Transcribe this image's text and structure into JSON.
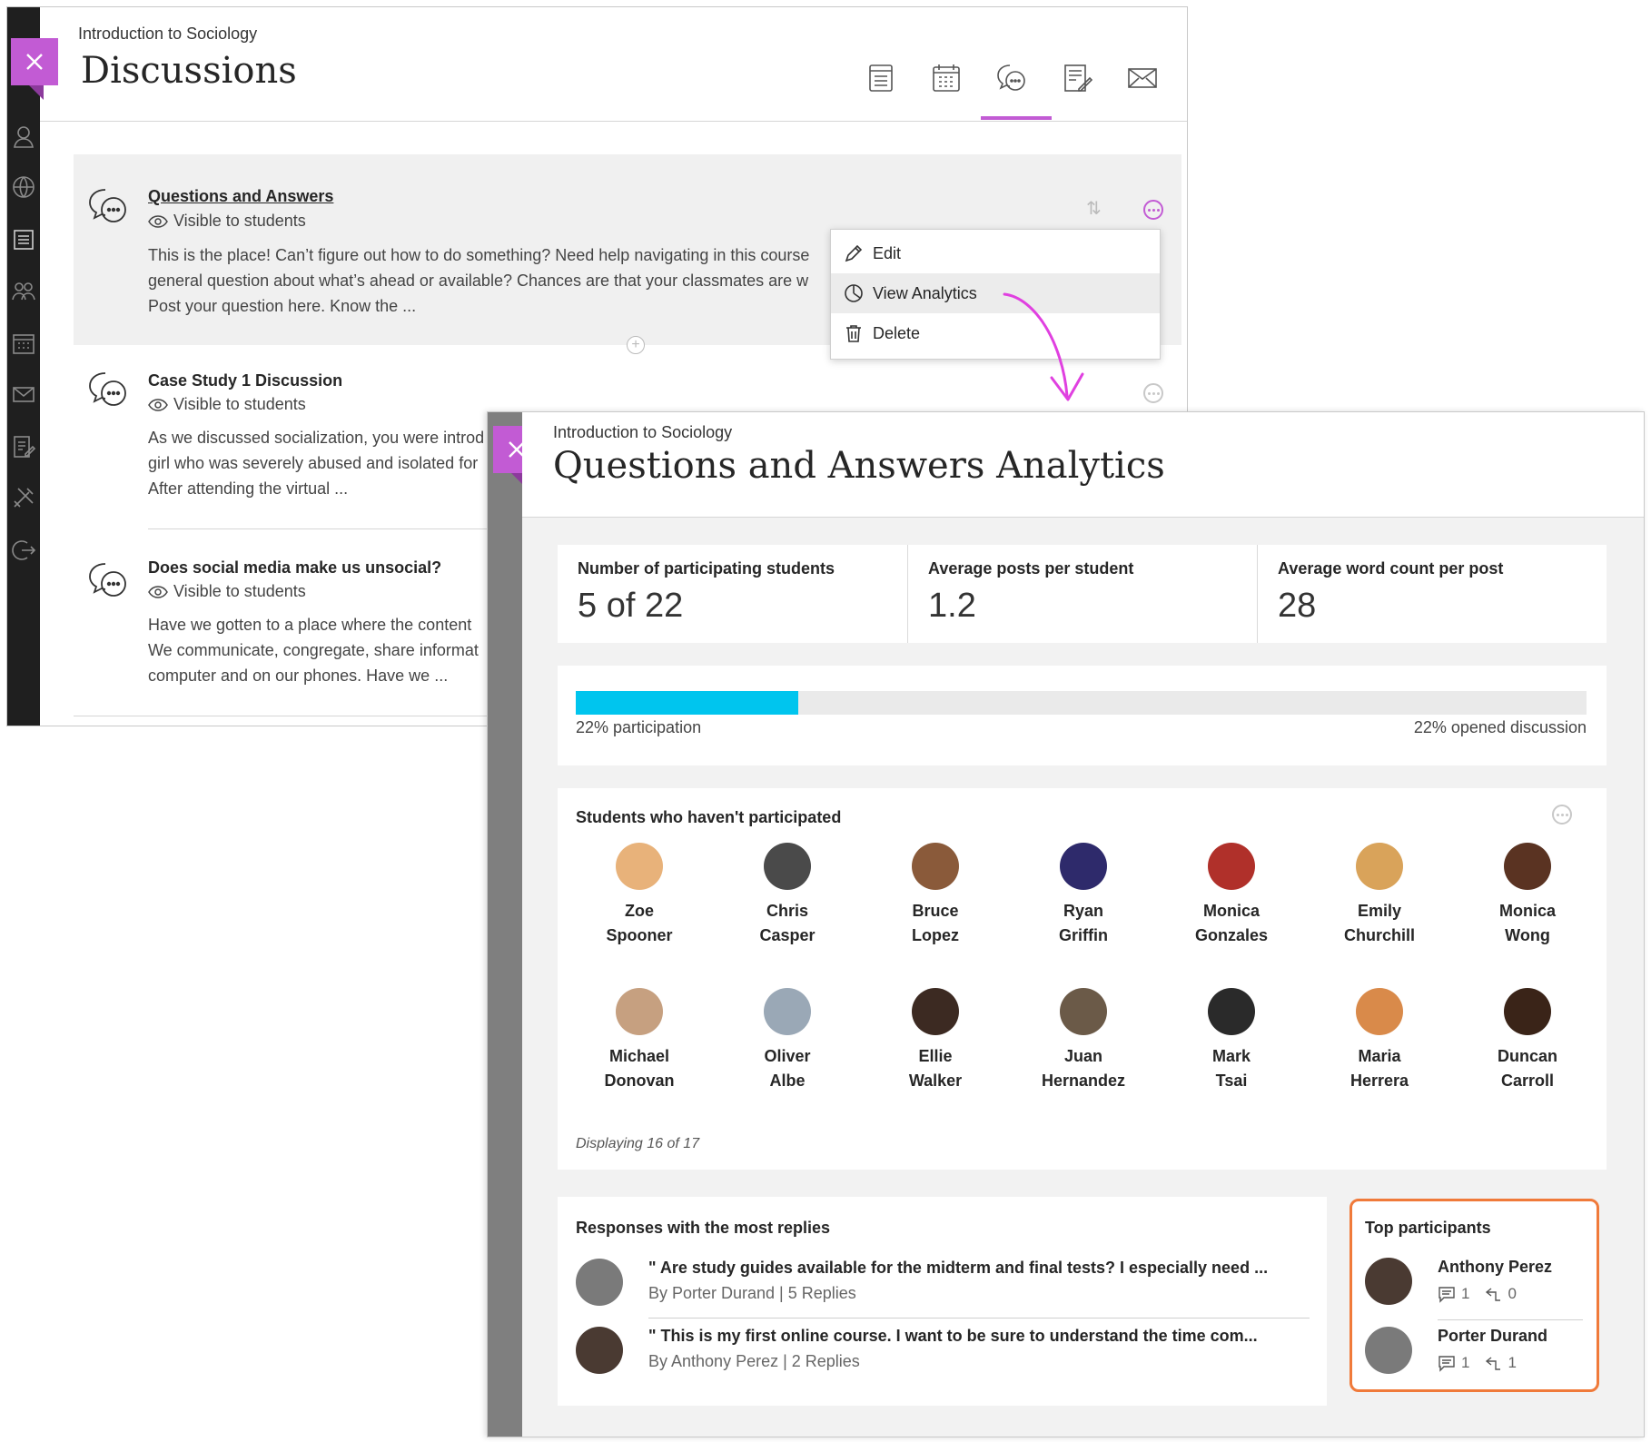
{
  "discussions_window": {
    "course": "Introduction to Sociology",
    "title": "Discussions",
    "toolbar_icons": [
      "content-icon",
      "calendar-icon",
      "discussions-icon",
      "gradebook-icon",
      "messages-icon"
    ],
    "items": [
      {
        "title": "Questions and Answers",
        "visibility": "Visible to students",
        "body": "This is the place! Can’t figure out how to do something? Need help navigating in this course\ngeneral question about what’s ahead or available? Chances are that your classmates are w\nPost your question here. Know the ..."
      },
      {
        "title": "Case Study 1 Discussion",
        "visibility": "Visible to students",
        "body": "As we discussed socialization, you were introd\ngirl who was severely abused and isolated for\nAfter attending the virtual ..."
      },
      {
        "title": "Does social media make us unsocial?",
        "visibility": "Visible to students",
        "body": "Have we gotten to a place where the content\nWe communicate, congregate, share informat\ncomputer and on our phones. Have we ..."
      }
    ],
    "menu": {
      "edit": "Edit",
      "view_analytics": "View Analytics",
      "delete": "Delete"
    }
  },
  "analytics_window": {
    "course": "Introduction to Sociology",
    "title": "Questions and Answers Analytics",
    "stats": [
      {
        "label": "Number of participating students",
        "value": "5 of 22"
      },
      {
        "label": "Average posts per student",
        "value": "1.2"
      },
      {
        "label": "Average word count per post",
        "value": "28"
      }
    ],
    "participation": {
      "fraction": 0.22,
      "left_label": "22% participation",
      "right_label": "22% opened discussion"
    },
    "non_participants": {
      "title": "Students who haven't participated",
      "students": [
        {
          "first": "Zoe",
          "last": "Spooner",
          "color": "#e8b27a"
        },
        {
          "first": "Chris",
          "last": "Casper",
          "color": "#4a4a4a"
        },
        {
          "first": "Bruce",
          "last": "Lopez",
          "color": "#8a5a3a"
        },
        {
          "first": "Ryan",
          "last": "Griffin",
          "color": "#2e2a6b"
        },
        {
          "first": "Monica",
          "last": "Gonzales",
          "color": "#b0302a"
        },
        {
          "first": "Emily",
          "last": "Churchill",
          "color": "#d9a35a"
        },
        {
          "first": "Monica",
          "last": "Wong",
          "color": "#5a3322"
        },
        {
          "first": "Michael",
          "last": "Donovan",
          "color": "#c6a080"
        },
        {
          "first": "Oliver",
          "last": "Albe",
          "color": "#9aa8b6"
        },
        {
          "first": "Ellie",
          "last": "Walker",
          "color": "#3c2a22"
        },
        {
          "first": "Juan",
          "last": "Hernandez",
          "color": "#6b5a48"
        },
        {
          "first": "Mark",
          "last": "Tsai",
          "color": "#2a2a2a"
        },
        {
          "first": "Maria",
          "last": "Herrera",
          "color": "#d98a4a"
        },
        {
          "first": "Duncan",
          "last": "Carroll",
          "color": "#3a2418"
        }
      ],
      "displaying": "Displaying 16 of 17"
    },
    "responses": {
      "title": "Responses with the most replies",
      "items": [
        {
          "quote": "\" Are study guides available for the midterm and final tests? I especially need ...",
          "meta": "By Porter Durand | 5 Replies",
          "color": "#7a7a7a"
        },
        {
          "quote": "\" This is my first online course. I want to be sure to understand the time com...",
          "meta": "By Anthony Perez | 2 Replies",
          "color": "#4a3a32"
        }
      ]
    },
    "top_participants": {
      "title": "Top participants",
      "items": [
        {
          "name": "Anthony Perez",
          "posts": "1",
          "replies": "0",
          "color": "#4a3a32"
        },
        {
          "name": "Porter Durand",
          "posts": "1",
          "replies": "1",
          "color": "#7a7a7a"
        }
      ]
    }
  }
}
